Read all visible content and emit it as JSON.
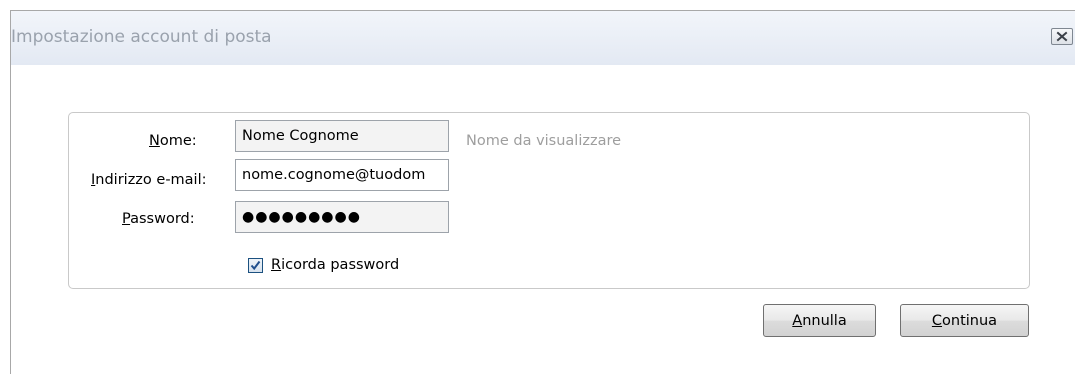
{
  "window": {
    "title": "Impostazione account di posta",
    "close_icon": "close-icon"
  },
  "form": {
    "name_label_mnemonic": "N",
    "name_label_rest": "ome:",
    "name_value": "Nome Cognome",
    "name_hint": "Nome da visualizzare",
    "email_label_mnemonic": "I",
    "email_label_rest": "ndirizzo e-mail:",
    "email_value": "nome.cognome@tuodom",
    "password_label_mnemonic": "P",
    "password_label_rest": "assword:",
    "password_value": "●●●●●●●●●",
    "remember_checked": true,
    "remember_label_mnemonic": "R",
    "remember_label_rest": "icorda password"
  },
  "buttons": {
    "cancel_mnemonic": "A",
    "cancel_rest": "nnulla",
    "continue_mnemonic": "C",
    "continue_rest": "ontinua"
  }
}
